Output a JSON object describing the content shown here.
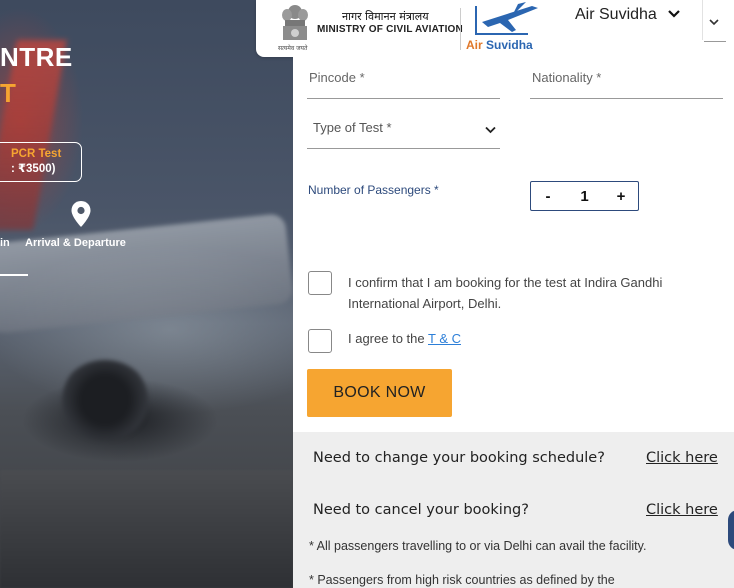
{
  "hero": {
    "title_line1": "NTRE",
    "title_line2": "T",
    "pcr_line1": "PCR Test",
    "pcr_line2": ": ₹3500)",
    "label_in": "in",
    "label_arrival": "Arrival & Departure"
  },
  "header": {
    "ministry_hindi": "नागर विमानन मंत्रालय",
    "ministry_english": "MINISTRY OF CIVIL AVIATION",
    "emblem_caption": "सत्यमेव जयते",
    "brand_air": "Air",
    "brand_suvidha": "Suvidha",
    "nav_dropdown_label": "Air Suvidha"
  },
  "form": {
    "pincode_placeholder": "Pincode *",
    "nationality_placeholder": "Nationality *",
    "type_of_test_placeholder": "Type of Test *",
    "passengers_label": "Number of Passengers *",
    "passengers_value": "1",
    "minus_label": "-",
    "plus_label": "+",
    "confirm_text": "I confirm that I am booking for the test at Indira Gandhi International Airport, Delhi.",
    "agree_prefix": "I agree to the ",
    "agree_link": "T & C",
    "book_button": "BOOK NOW"
  },
  "info": {
    "change_question": "Need to change your booking schedule?",
    "change_link": "Click here",
    "cancel_question": "Need to cancel your booking?",
    "cancel_link": "Click here",
    "note1": "* All passengers travelling to or via Delhi can avail the facility.",
    "note2": "* Passengers from high risk countries as defined by the"
  },
  "colors": {
    "accent_orange": "#f6a531",
    "brand_blue": "#2b66b1",
    "label_navy": "#2d4a7c",
    "link_blue": "#2d7fd8"
  }
}
